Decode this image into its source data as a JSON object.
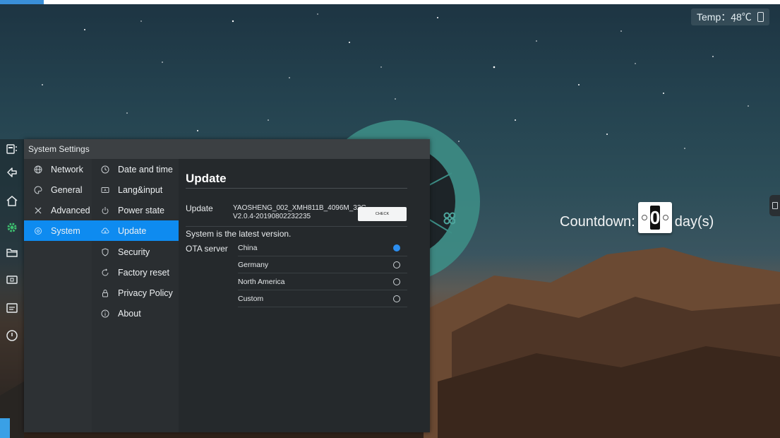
{
  "status": {
    "temperature": "Temp：48℃",
    "usb_icon": "usb-drive-icon"
  },
  "countdown": {
    "label": "Countdown:",
    "value": "0",
    "unit": "day(s)"
  },
  "settings": {
    "title": "System Settings",
    "categories": [
      {
        "label": "Network",
        "icon": "globe-icon"
      },
      {
        "label": "General",
        "icon": "palette-icon"
      },
      {
        "label": "Advanced",
        "icon": "tools-icon"
      },
      {
        "label": "System",
        "icon": "gear-icon",
        "selected": true
      }
    ],
    "subitems": [
      {
        "label": "Date and time",
        "icon": "clock-icon"
      },
      {
        "label": "Lang&input",
        "icon": "keyboard-icon"
      },
      {
        "label": "Power state",
        "icon": "power-icon"
      },
      {
        "label": "Update",
        "icon": "cloud-icon",
        "selected": true
      },
      {
        "label": "Security",
        "icon": "shield-icon"
      },
      {
        "label": "Factory reset",
        "icon": "reset-icon"
      },
      {
        "label": "Privacy Policy",
        "icon": "lock-icon"
      },
      {
        "label": "About",
        "icon": "info-icon"
      }
    ],
    "update": {
      "heading": "Update",
      "label": "Update",
      "version": "YAOSHENG_002_XMH811B_4096M_32G-V2.0.4-20190802232235",
      "check_button": "CHECK",
      "status": "System is the latest version.",
      "ota_label": "OTA server",
      "ota_options": [
        {
          "label": "China",
          "selected": true
        },
        {
          "label": "Germany",
          "selected": false
        },
        {
          "label": "North America",
          "selected": false
        },
        {
          "label": "Custom",
          "selected": false
        }
      ]
    }
  },
  "sidebar": {
    "items": [
      "menu-icon",
      "back-icon",
      "home-icon",
      "settings-gear-icon",
      "folder-icon",
      "screen-input-icon",
      "whiteboard-icon",
      "power-icon"
    ]
  },
  "colors": {
    "accent": "#0e8bf0",
    "window_bg": "#262a2d",
    "dial": "#3d8e86"
  }
}
